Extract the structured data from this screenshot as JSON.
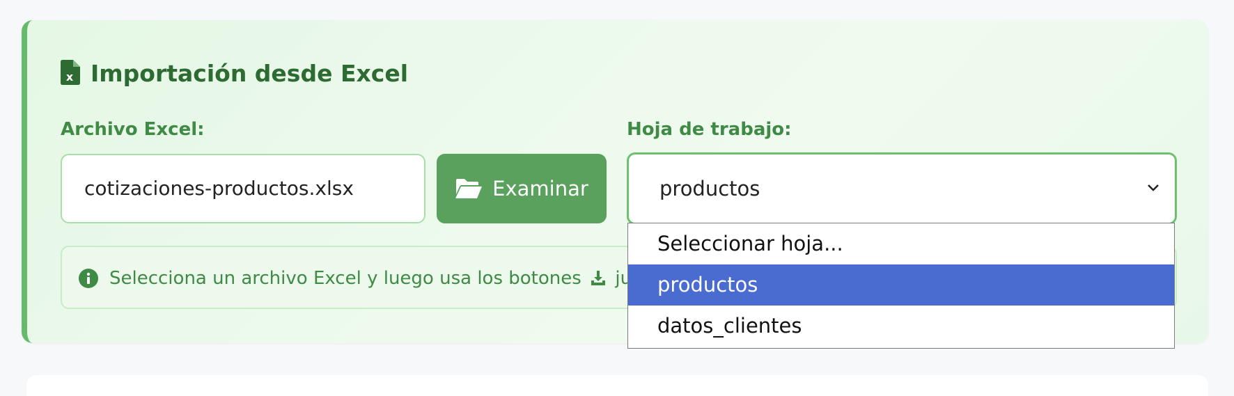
{
  "section": {
    "title": "Importación desde Excel",
    "title_icon": "excel-file-icon",
    "accent_color": "#66bb6a",
    "title_color": "#2e6b32"
  },
  "file": {
    "label": "Archivo Excel:",
    "value": "cotizaciones-productos.xlsx",
    "browse_label": "Examinar",
    "browse_icon": "folder-open-icon",
    "button_color": "#5ba15e"
  },
  "sheet": {
    "label": "Hoja de trabajo:",
    "selected": "productos",
    "options": [
      "Seleccionar hoja...",
      "productos",
      "datos_clientes"
    ],
    "highlight_color": "#4a6bd0"
  },
  "info": {
    "icon": "info-circle-icon",
    "text_before": "Selecciona un archivo Excel y luego usa los botones",
    "inline_icon": "download-icon",
    "text_after": "junto"
  }
}
